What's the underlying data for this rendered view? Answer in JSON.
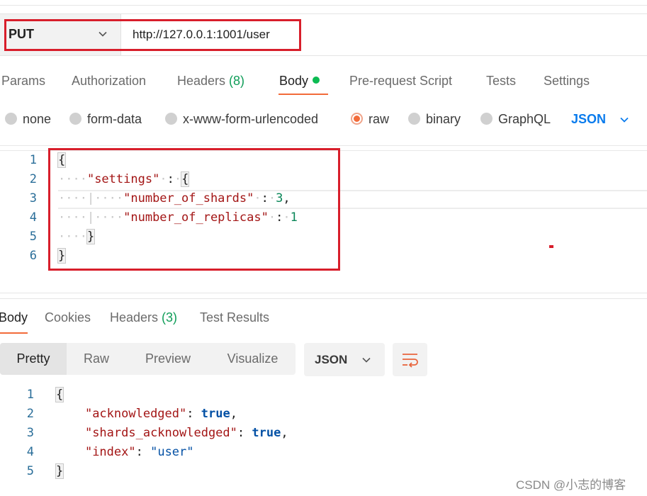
{
  "request": {
    "method": "PUT",
    "url": "http://127.0.0.1:1001/user"
  },
  "request_tabs": [
    {
      "label": "Params"
    },
    {
      "label": "Authorization"
    },
    {
      "label": "Headers ",
      "count": "(8)"
    },
    {
      "label": "Body"
    },
    {
      "label": "Pre-request Script"
    },
    {
      "label": "Tests"
    },
    {
      "label": "Settings"
    }
  ],
  "active_request_tab": "Body",
  "body_types": [
    {
      "label": "none",
      "selected": false
    },
    {
      "label": "form-data",
      "selected": false
    },
    {
      "label": "x-www-form-urlencoded",
      "selected": false
    },
    {
      "label": "raw",
      "selected": true
    },
    {
      "label": "binary",
      "selected": false
    },
    {
      "label": "GraphQL",
      "selected": false
    }
  ],
  "body_format": "JSON",
  "request_body_lines": [
    "1",
    "2",
    "3",
    "4",
    "5",
    "6"
  ],
  "request_body": {
    "open_brace": "{",
    "settings_key": "\"settings\"",
    "shards_key": "\"number_of_shards\"",
    "shards_value": "3",
    "replicas_key": "\"number_of_replicas\"",
    "replicas_value": "1",
    "inner_close": "}",
    "close_brace": "}"
  },
  "response_tabs": [
    {
      "label": "Body"
    },
    {
      "label": "Cookies"
    },
    {
      "label": "Headers ",
      "count": "(3)"
    },
    {
      "label": "Test Results"
    }
  ],
  "response_views": [
    "Pretty",
    "Raw",
    "Preview",
    "Visualize"
  ],
  "active_response_view": "Pretty",
  "response_format": "JSON",
  "response_body_lines": [
    "1",
    "2",
    "3",
    "4",
    "5"
  ],
  "response_body": {
    "open_brace": "{",
    "ack_key": "\"acknowledged\"",
    "ack_value": "true",
    "shards_ack_key": "\"shards_acknowledged\"",
    "shards_ack_value": "true",
    "index_key": "\"index\"",
    "index_value": "\"user\"",
    "close_brace": "}"
  },
  "watermark": "CSDN @小志的博客",
  "colors": {
    "accent": "#f26b3a",
    "annotation_red": "#d81e2b",
    "json_blue": "#097bed",
    "count_green": "#0f9d58"
  }
}
